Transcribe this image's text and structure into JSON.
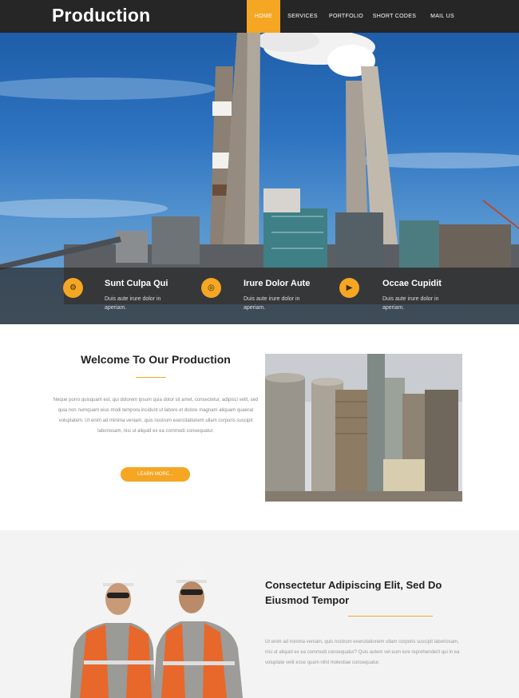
{
  "header": {
    "logo": "Production",
    "menu": [
      {
        "label": "HOME",
        "active": true
      },
      {
        "label": "SERVICES",
        "active": false
      },
      {
        "label": "PORTFOLIO",
        "active": false
      },
      {
        "label": "SHORT CODES",
        "active": false
      },
      {
        "label": "MAIL US",
        "active": false
      }
    ]
  },
  "hero": {
    "features": [
      {
        "icon": "gear-icon",
        "title": "Sunt Culpa Qui",
        "text": "Duis aute irure dolor in aperiam."
      },
      {
        "icon": "target-icon",
        "title": "Irure Dolor Aute",
        "text": "Duis aute irure dolor in aperiam."
      },
      {
        "icon": "megaphone-icon",
        "title": "Occae Cupidit",
        "text": "Duis aute irure dolor in aperiam."
      }
    ]
  },
  "welcome": {
    "title": "Welcome To Our Production",
    "text": "Neque porro quisquam est, qui dolorem ipsum quia dolor sit amet, consectetur, adipisci velit, sed quia non numquam eius modi tempora incidunt ut labore et dolore magnam aliquam quaerat voluptatem. Ut enim ad minima veniam, quis nostrum exercitationem ullam corporis suscipit laboriosam, nisi ut aliquid ex ea commodi consequatur.",
    "button": "LEARN MORE..."
  },
  "about": {
    "title": "Consectetur Adipiscing Elit, Sed Do Eiusmod Tempor",
    "text": "Ut enim ad minima veniam, quis nostrum exercitationem ullam corporis suscipit laboriosam, nisi ut aliquid ex ea commodi consequatur? Quis autem vel eum iure reprehenderit qui in ea voluptate velit esse quam nihil molestiae consequatur."
  },
  "colors": {
    "accent": "#f5a623",
    "nav": "#262626"
  }
}
